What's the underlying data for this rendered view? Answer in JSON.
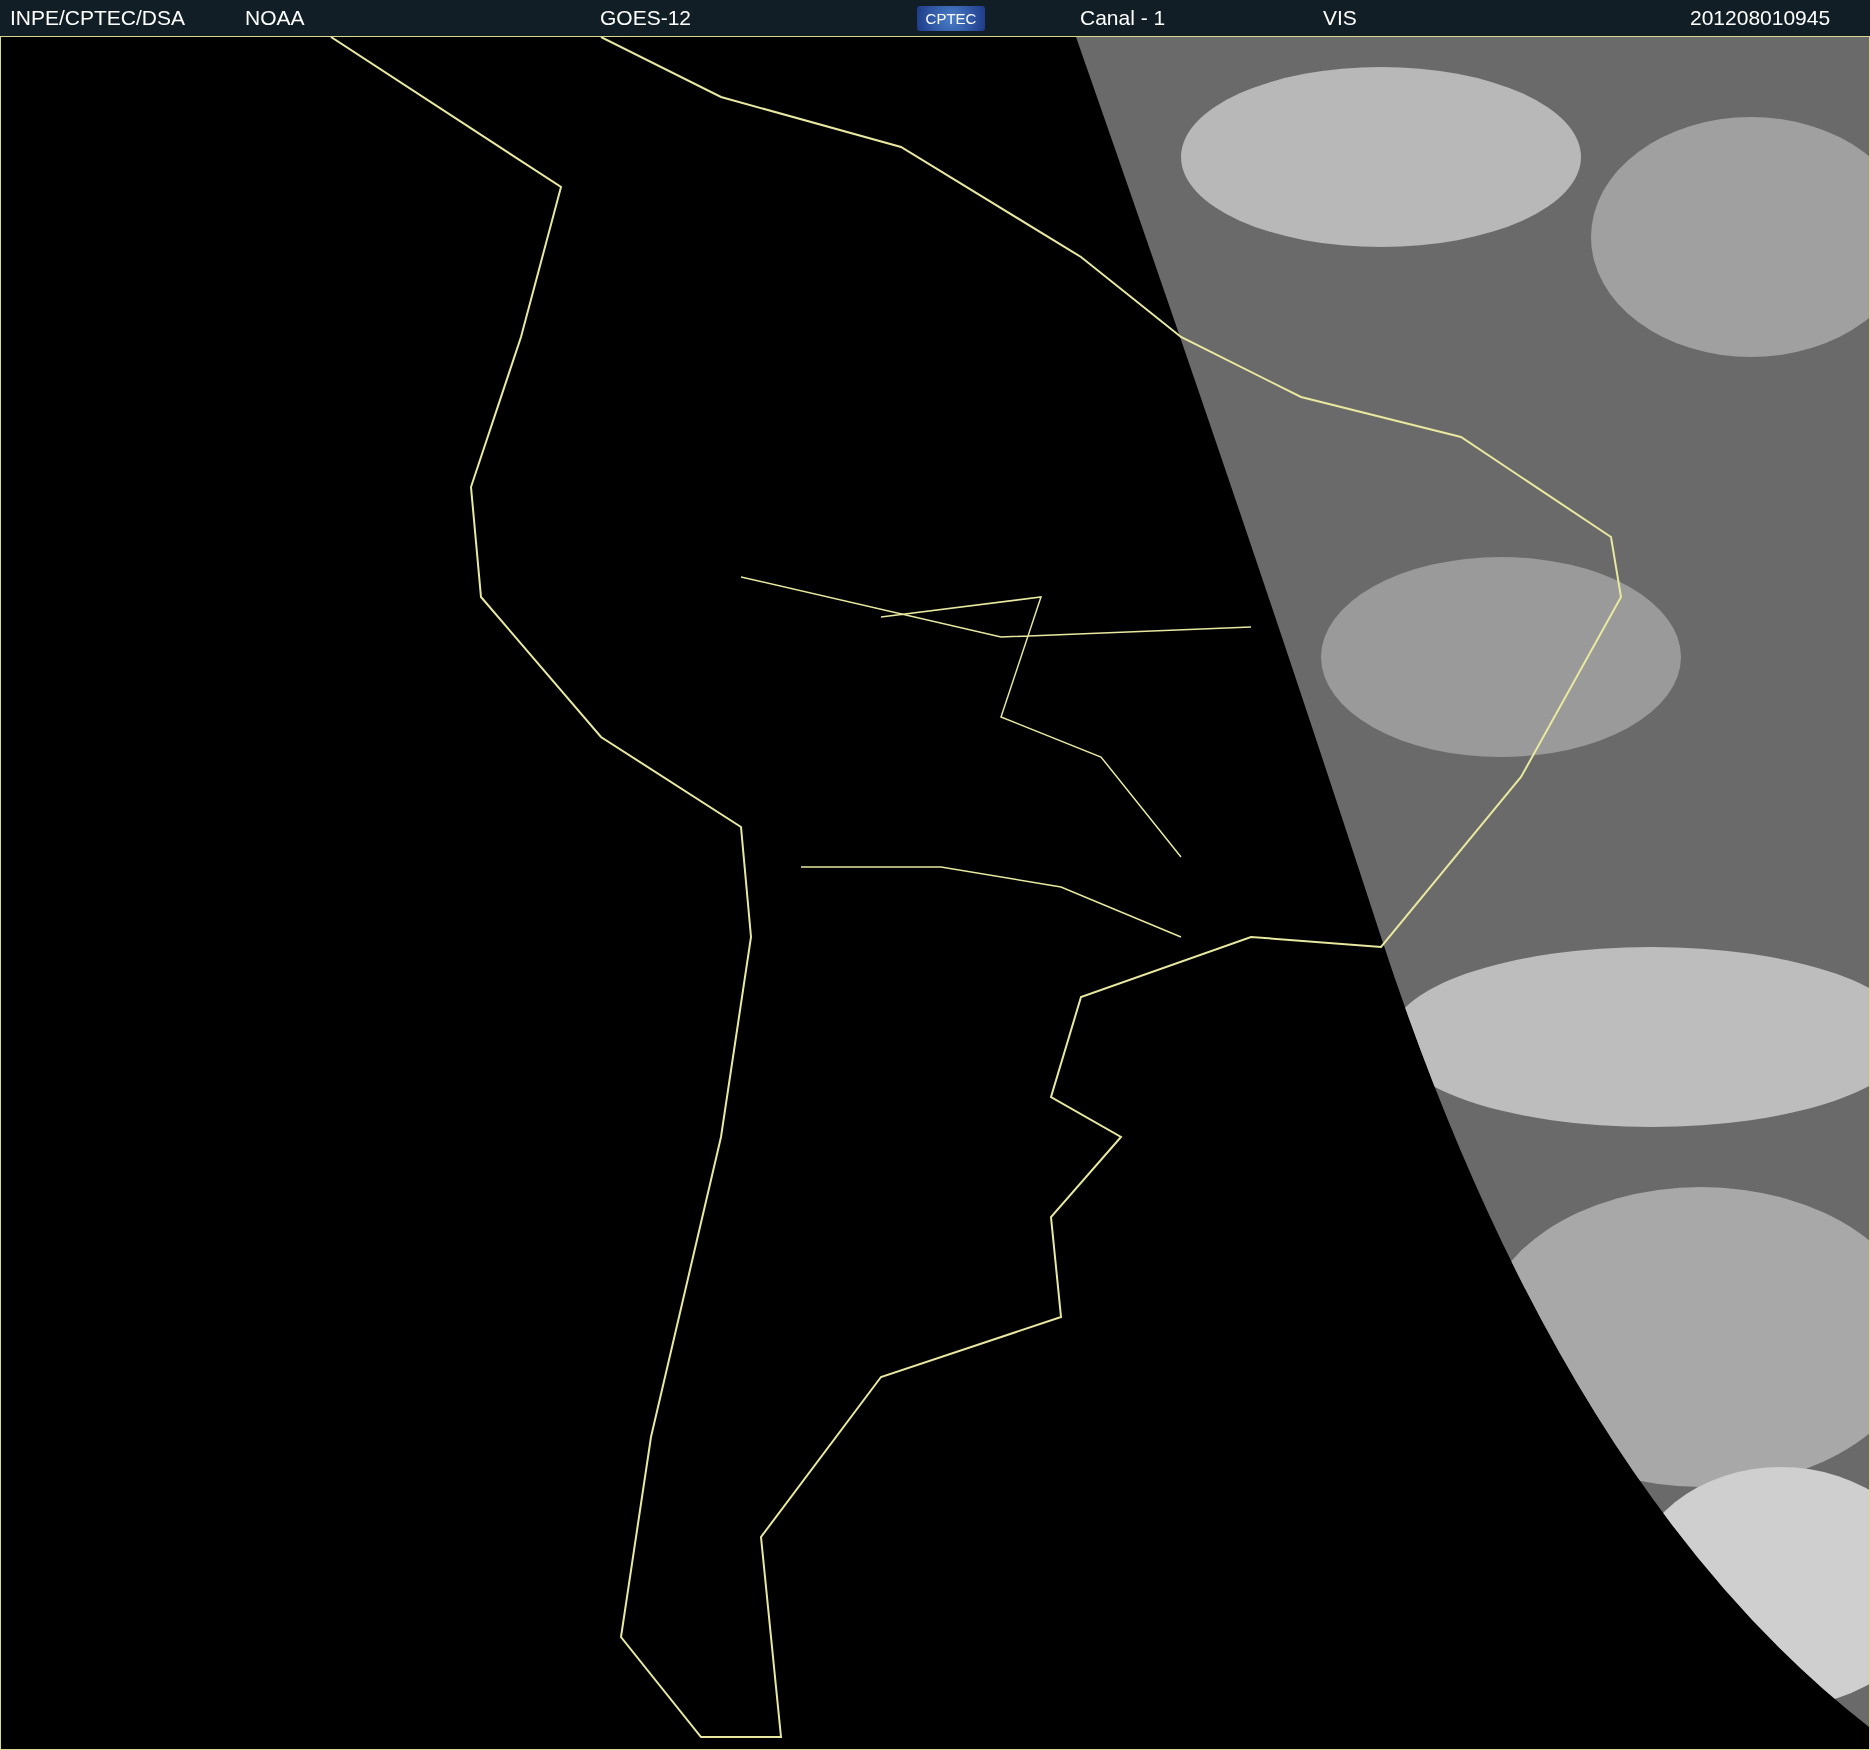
{
  "header": {
    "institution": "INPE/CPTEC/DSA",
    "agency": "NOAA",
    "satellite": "GOES-12",
    "logo_text": "CPTEC",
    "channel": "Canal - 1",
    "band": "VIS",
    "timestamp": "201208010945"
  }
}
